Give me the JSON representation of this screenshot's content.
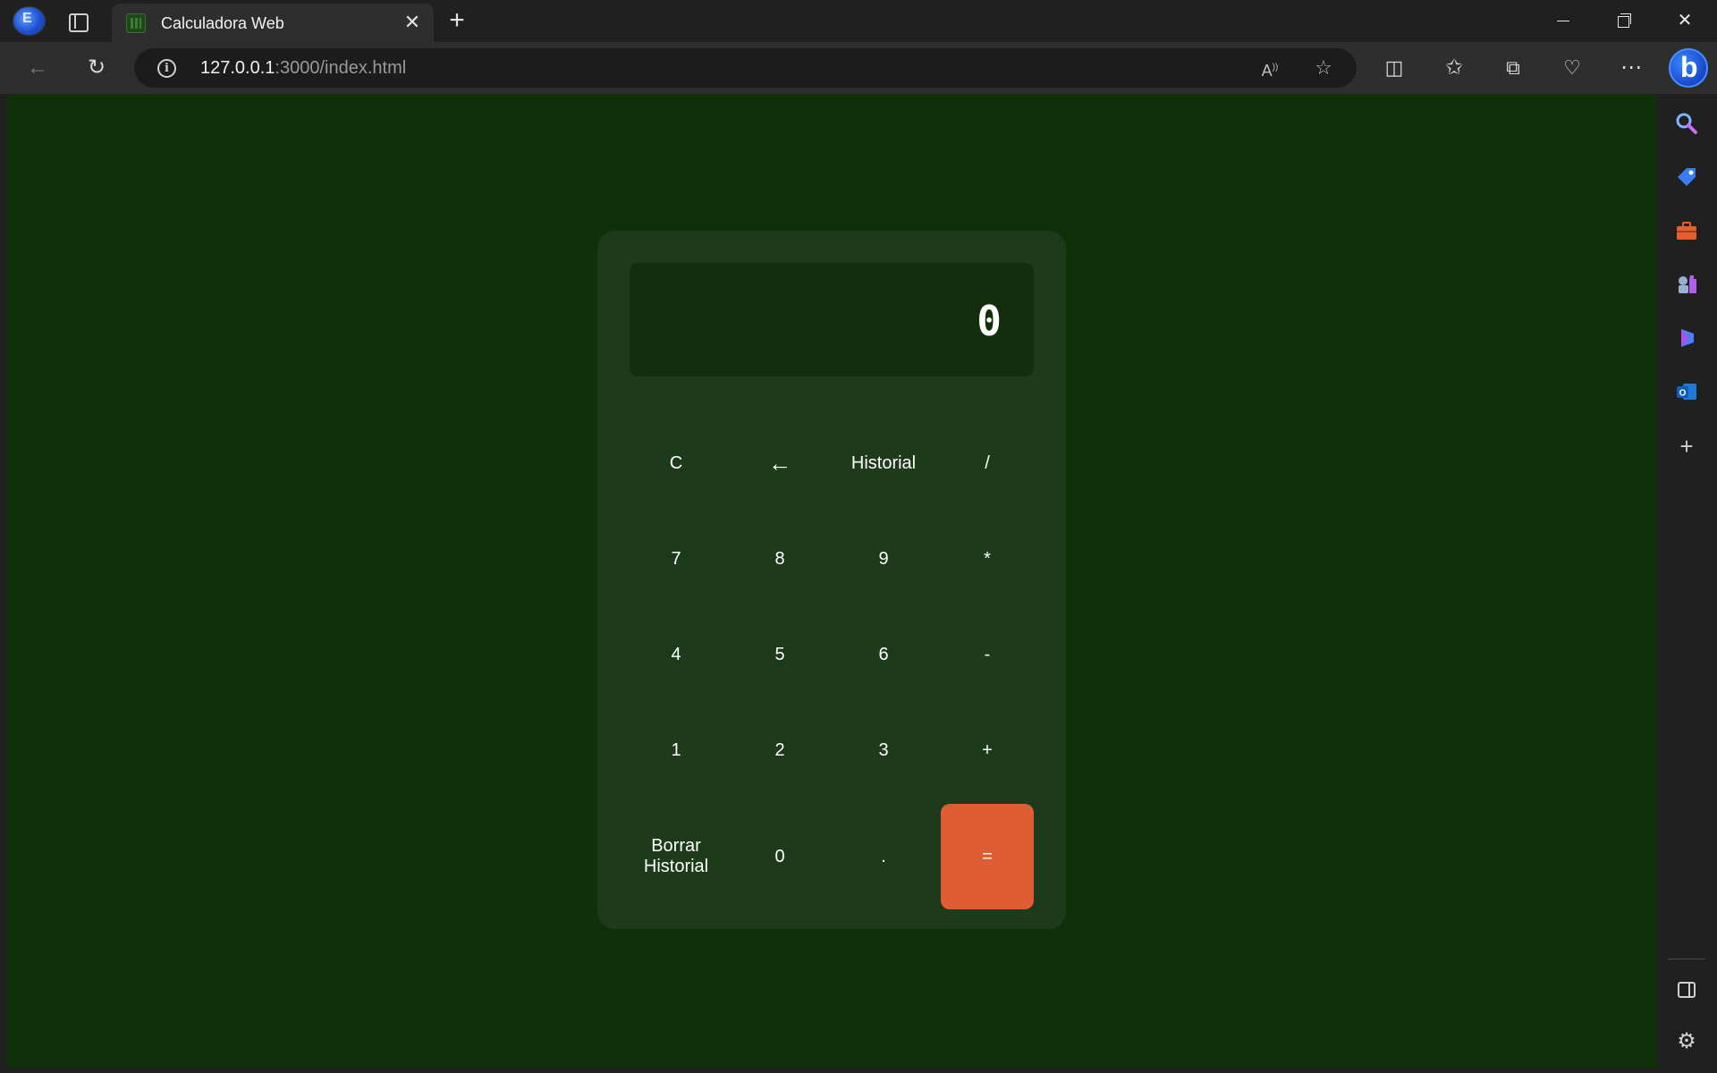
{
  "browser": {
    "tab": {
      "title": "Calculadora Web"
    },
    "address": {
      "host": "127.0.0.1",
      "path": ":3000/index.html"
    }
  },
  "calculator": {
    "display": "0",
    "keys": {
      "clear": "C",
      "backspace": "←",
      "history": "Historial",
      "divide": "/",
      "seven": "7",
      "eight": "8",
      "nine": "9",
      "multiply": "*",
      "four": "4",
      "five": "5",
      "six": "6",
      "subtract": "-",
      "one": "1",
      "two": "2",
      "three": "3",
      "add": "+",
      "clear_history_line1": "Borrar",
      "clear_history_line2": "Historial",
      "zero": "0",
      "decimal": ".",
      "equals": "="
    }
  },
  "colors": {
    "page_background": "#103009",
    "calculator_body": "#1d3a1a",
    "display_background": "#132e0d",
    "equals_button": "#e05d34"
  },
  "icons": {
    "toolbar": [
      "back-icon",
      "refresh-icon",
      "info-icon",
      "read-aloud-icon",
      "favorite-star-icon",
      "split-screen-icon",
      "favorites-icon",
      "collections-icon",
      "browser-essentials-icon",
      "more-menu-icon",
      "bing-copilot-icon"
    ],
    "sidebar": [
      "search-icon",
      "shopping-tag-icon",
      "tools-icon",
      "games-icon",
      "copilot-icon",
      "outlook-icon",
      "add-icon",
      "hide-sidebar-icon",
      "settings-icon"
    ]
  }
}
